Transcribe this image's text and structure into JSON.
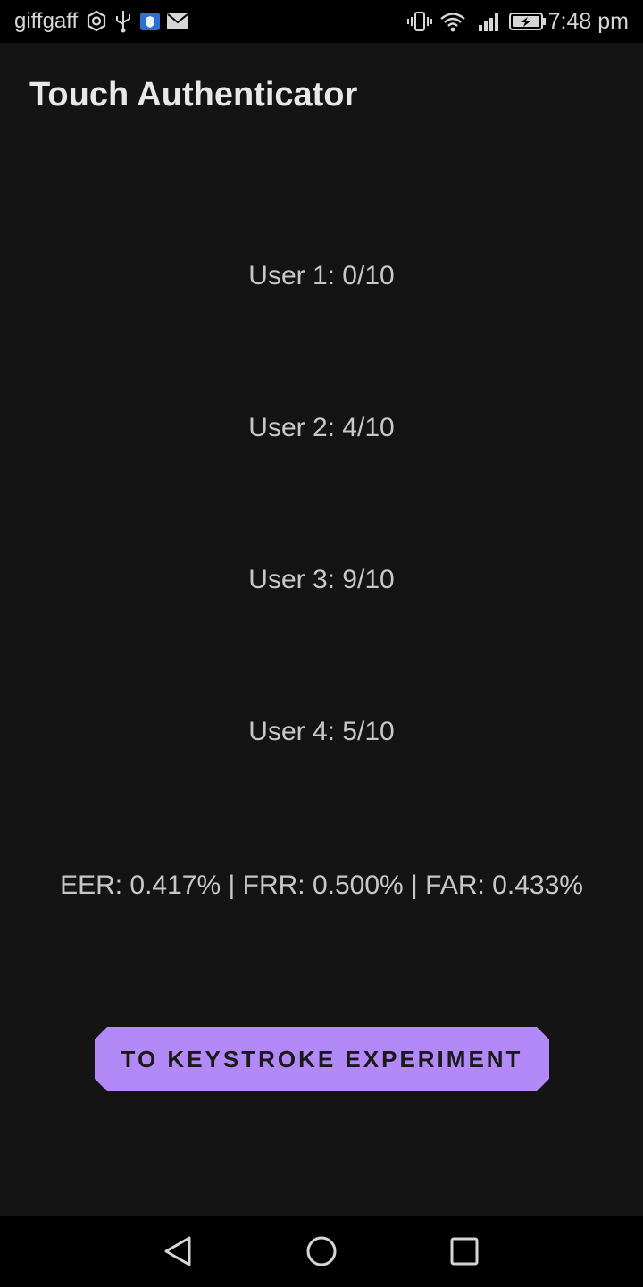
{
  "status_bar": {
    "carrier": "giffgaff",
    "time": "7:48 pm",
    "icons": [
      "vpn-icon",
      "usb-icon",
      "shield-icon",
      "mail-icon",
      "vibrate-icon",
      "wifi-icon",
      "signal-icon",
      "battery-charging-icon"
    ]
  },
  "app": {
    "title": "Touch Authenticator"
  },
  "scores": [
    "User 1: 0/10",
    "User 2: 4/10",
    "User 3: 9/10",
    "User 4: 5/10"
  ],
  "metrics": "EER: 0.417% | FRR: 0.500% | FAR: 0.433%",
  "button": {
    "label": "TO KEYSTROKE EXPERIMENT"
  },
  "navigation": {
    "buttons": [
      "back-icon",
      "home-icon",
      "recents-icon"
    ]
  },
  "colors": {
    "background": "#141414",
    "accent": "#b388f7",
    "text": "#c8c8c8"
  }
}
